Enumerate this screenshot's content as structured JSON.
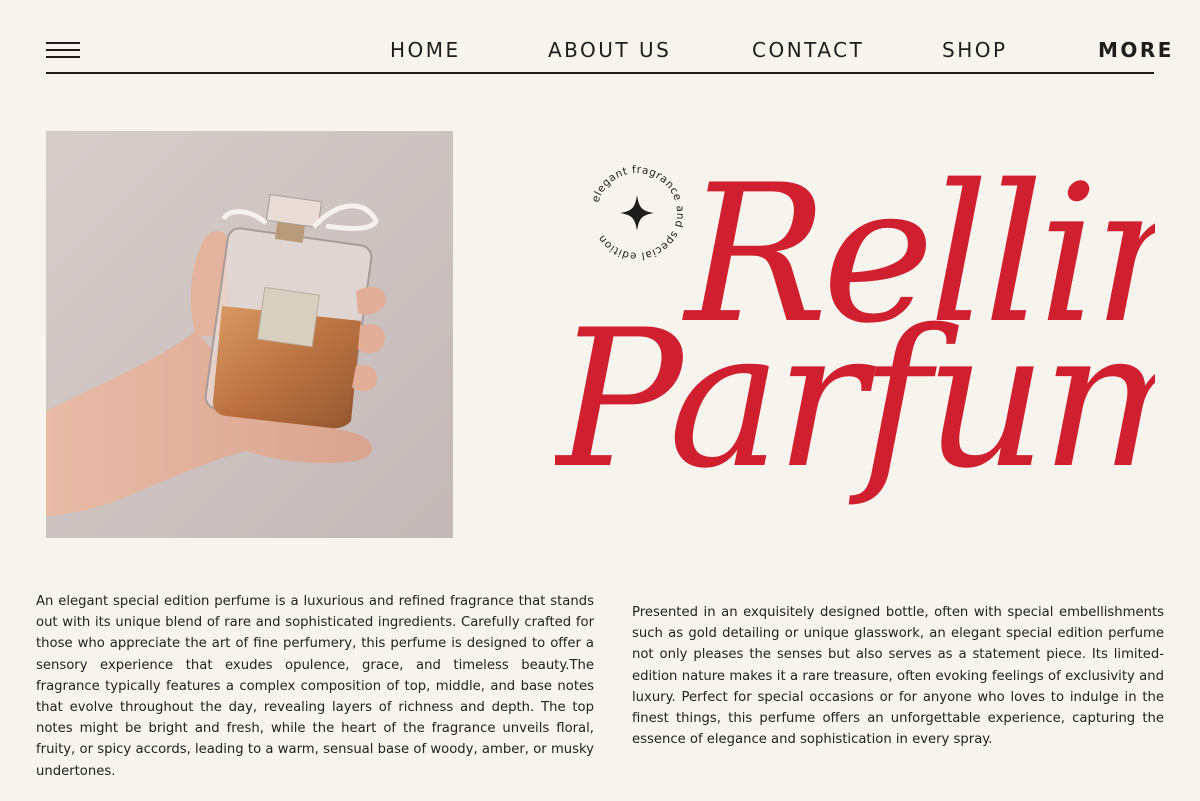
{
  "header": {
    "nav": [
      "HOME",
      "ABOUT US",
      "CONTACT",
      "SHOP",
      "MORE"
    ]
  },
  "stamp": {
    "text": "elegant fragrance and special edition"
  },
  "title": {
    "line1": "Rellina",
    "line2": "Parfume",
    "color": "#d0202f"
  },
  "body": {
    "left": "An elegant special edition perfume is a luxurious and refined fragrance that stands out with its unique blend of rare and sophisticated ingredients. Carefully crafted for those who appreciate the art of fine perfumery, this perfume is designed to offer a sensory experience that exudes opulence, grace, and timeless beauty.The fragrance typically features a complex composition of top, middle, and base notes that evolve throughout the day, revealing layers of richness and depth. The top notes might be bright and fresh, while the heart of the fragrance unveils floral, fruity, or spicy accords, leading to a warm, sensual base of woody, amber, or musky undertones.",
    "right": "Presented in an exquisitely designed bottle, often with special embellishments such as gold detailing or unique glasswork, an elegant special edition perfume not only pleases the senses but also serves as a statement piece. Its limited-edition nature makes it a rare treasure, often evoking feelings of exclusivity and luxury. Perfect for special occasions or for anyone who loves to indulge in the finest things, this perfume offers an unforgettable experience, capturing the essence of elegance and sophistication in every spray."
  }
}
